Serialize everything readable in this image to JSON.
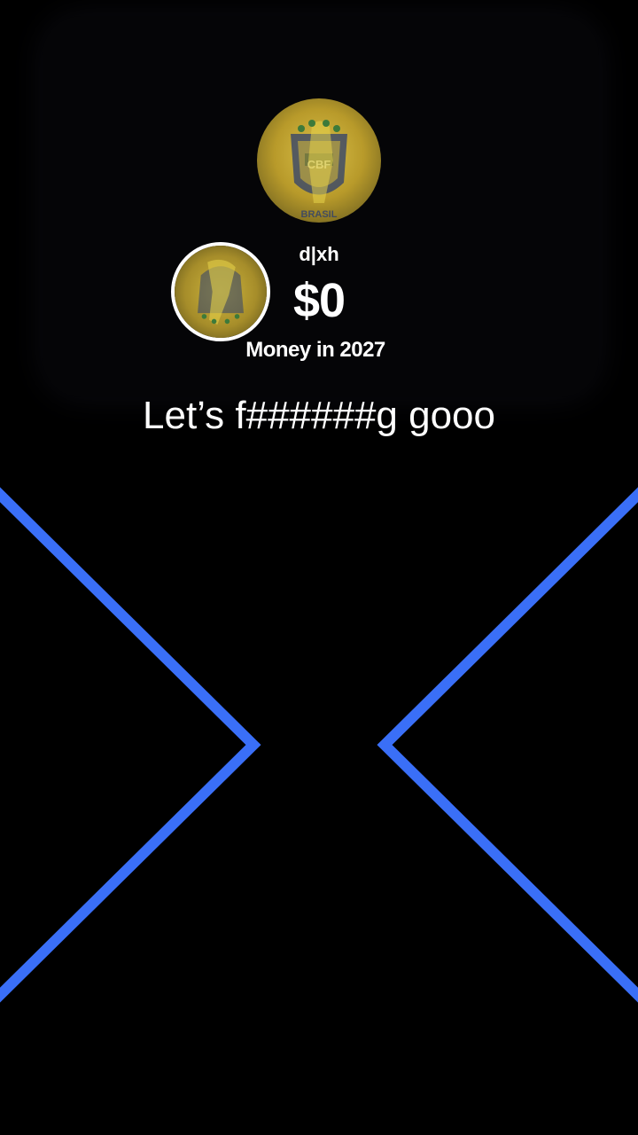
{
  "profile": {
    "username": "d|xh",
    "amount": "$0",
    "subtitle": "Money in 2027",
    "avatar_crest_text": "CBF",
    "avatar_country_text": "BRASIL"
  },
  "caption": {
    "text": "Let’s f######g gooo"
  },
  "colors": {
    "background": "#000000",
    "chevron": "#3a6ff7",
    "text": "#ffffff",
    "avatar_yellow": "#c9a92a"
  },
  "icons": {
    "large_avatar": "brazil-crest-avatar",
    "small_avatar": "brazil-crest-avatar"
  }
}
